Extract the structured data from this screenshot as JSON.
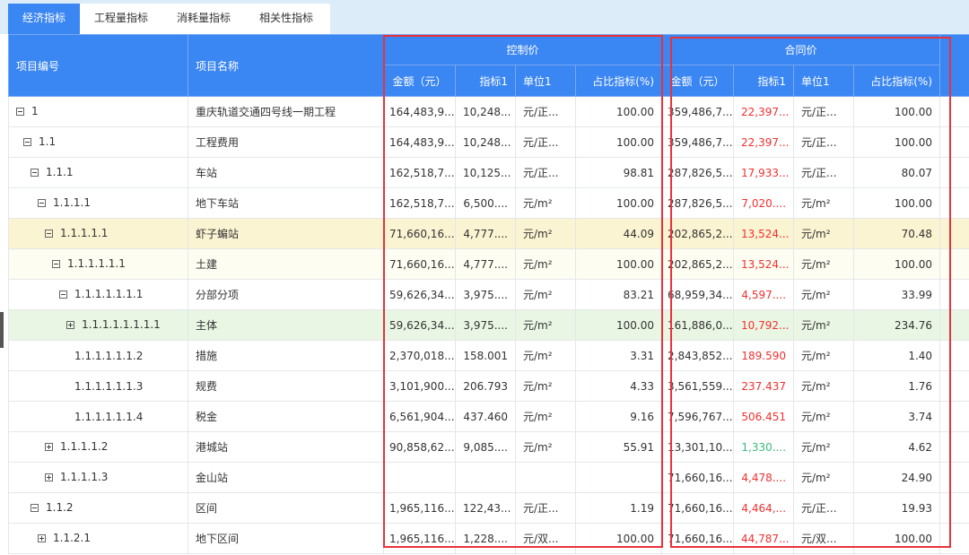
{
  "tabs": [
    {
      "label": "经济指标",
      "active": true
    },
    {
      "label": "工程量指标",
      "active": false
    },
    {
      "label": "消耗量指标",
      "active": false
    },
    {
      "label": "相关性指标",
      "active": false
    }
  ],
  "header": {
    "code": "项目编号",
    "name": "项目名称",
    "control_group": "控制价",
    "contract_group": "合同价",
    "control_cols": [
      "金额（元）",
      "指标1",
      "单位1",
      "占比指标(%)"
    ],
    "contract_cols": [
      "金额（元）",
      "指标1",
      "单位1",
      "占比指标(%)"
    ]
  },
  "rows": [
    {
      "code": "1",
      "toggle": "minus",
      "name": "重庆轨道交通四号线一期工程",
      "c_amt": "164,483,9...",
      "c_idx": "10,248...",
      "c_unit": "元/正...",
      "c_pct": "100.00",
      "h_amt": "359,486,7...",
      "h_idx": "22,397...",
      "h_unit": "元/正...",
      "h_pct": "100.00"
    },
    {
      "code": "1.1",
      "toggle": "minus",
      "name": "工程费用",
      "c_amt": "164,483,9...",
      "c_idx": "10,248...",
      "c_unit": "元/正...",
      "c_pct": "100.00",
      "h_amt": "359,486,7...",
      "h_idx": "22,397...",
      "h_unit": "元/正...",
      "h_pct": "100.00"
    },
    {
      "code": "1.1.1",
      "toggle": "minus",
      "name": "车站",
      "c_amt": "162,518,7...",
      "c_idx": "10,125...",
      "c_unit": "元/正...",
      "c_pct": "98.81",
      "h_amt": "287,826,5...",
      "h_idx": "17,933...",
      "h_unit": "元/正...",
      "h_pct": "80.07"
    },
    {
      "code": "1.1.1.1",
      "toggle": "minus",
      "name": "地下车站",
      "c_amt": "162,518,7...",
      "c_idx": "6,500....",
      "c_unit": "元/m²",
      "c_pct": "100.00",
      "h_amt": "287,826,5...",
      "h_idx": "7,020....",
      "h_unit": "元/m²",
      "h_pct": "100.00"
    },
    {
      "code": "1.1.1.1.1",
      "toggle": "minus",
      "name": "虾子蝙站",
      "c_amt": "71,660,16...",
      "c_idx": "4,777....",
      "c_unit": "元/m²",
      "c_pct": "44.09",
      "h_amt": "202,865,2...",
      "h_idx": "13,524...",
      "h_unit": "元/m²",
      "h_pct": "70.48"
    },
    {
      "code": "1.1.1.1.1.1",
      "toggle": "minus",
      "name": "土建",
      "c_amt": "71,660,16...",
      "c_idx": "4,777....",
      "c_unit": "元/m²",
      "c_pct": "100.00",
      "h_amt": "202,865,2...",
      "h_idx": "13,524...",
      "h_unit": "元/m²",
      "h_pct": "100.00"
    },
    {
      "code": "1.1.1.1.1.1.1",
      "toggle": "minus",
      "name": "分部分项",
      "c_amt": "59,626,34...",
      "c_idx": "3,975....",
      "c_unit": "元/m²",
      "c_pct": "83.21",
      "h_amt": "68,959,34...",
      "h_idx": "4,597....",
      "h_unit": "元/m²",
      "h_pct": "33.99"
    },
    {
      "code": "1.1.1.1.1.1.1.1",
      "toggle": "plus",
      "name": "主体",
      "c_amt": "59,626,34...",
      "c_idx": "3,975....",
      "c_unit": "元/m²",
      "c_pct": "100.00",
      "h_amt": "161,886,0...",
      "h_idx": "10,792...",
      "h_unit": "元/m²",
      "h_pct": "234.76"
    },
    {
      "code": "1.1.1.1.1.1.2",
      "toggle": "none",
      "name": "措施",
      "c_amt": "2,370,018....",
      "c_idx": "158.001",
      "c_unit": "元/m²",
      "c_pct": "3.31",
      "h_amt": "2,843,852....",
      "h_idx": "189.590",
      "h_unit": "元/m²",
      "h_pct": "1.40"
    },
    {
      "code": "1.1.1.1.1.1.3",
      "toggle": "none",
      "name": "规费",
      "c_amt": "3,101,900....",
      "c_idx": "206.793",
      "c_unit": "元/m²",
      "c_pct": "4.33",
      "h_amt": "3,561,559....",
      "h_idx": "237.437",
      "h_unit": "元/m²",
      "h_pct": "1.76"
    },
    {
      "code": "1.1.1.1.1.1.4",
      "toggle": "none",
      "name": "税金",
      "c_amt": "6,561,904....",
      "c_idx": "437.460",
      "c_unit": "元/m²",
      "c_pct": "9.16",
      "h_amt": "7,596,767....",
      "h_idx": "506.451",
      "h_unit": "元/m²",
      "h_pct": "3.74"
    },
    {
      "code": "1.1.1.1.2",
      "toggle": "plus",
      "name": "港城站",
      "c_amt": "90,858,62...",
      "c_idx": "9,085....",
      "c_unit": "元/m²",
      "c_pct": "55.91",
      "h_amt": "13,301,10...",
      "h_idx": "1,330....",
      "h_unit": "元/m²",
      "h_pct": "4.62"
    },
    {
      "code": "1.1.1.1.3",
      "toggle": "plus",
      "name": "金山站",
      "c_amt": "",
      "c_idx": "",
      "c_unit": "",
      "c_pct": "",
      "h_amt": "71,660,16...",
      "h_idx": "4,478....",
      "h_unit": "元/m²",
      "h_pct": "24.90"
    },
    {
      "code": "1.1.2",
      "toggle": "minus",
      "name": "区间",
      "c_amt": "1,965,116....",
      "c_idx": "122,43...",
      "c_unit": "元/正...",
      "c_pct": "1.19",
      "h_amt": "71,660,16...",
      "h_idx": "4,464,...",
      "h_unit": "元/正...",
      "h_pct": "19.93"
    },
    {
      "code": "1.1.2.1",
      "toggle": "plus",
      "name": "地下区间",
      "c_amt": "1,965,116....",
      "c_idx": "1,228....",
      "c_unit": "元/双...",
      "c_pct": "100.00",
      "h_amt": "71,660,16...",
      "h_idx": "44,787...",
      "h_unit": "元/双...",
      "h_pct": "100.00"
    }
  ],
  "colors": {
    "header_blue": "#3a86f2",
    "highlight_box": "#e8323c",
    "contract_index_text": "#f23030",
    "contract_index_text_alt": "#3cba7c",
    "row_highlight_yellow": "#fbf4d2",
    "row_highlight_green": "#eaf6e4"
  }
}
